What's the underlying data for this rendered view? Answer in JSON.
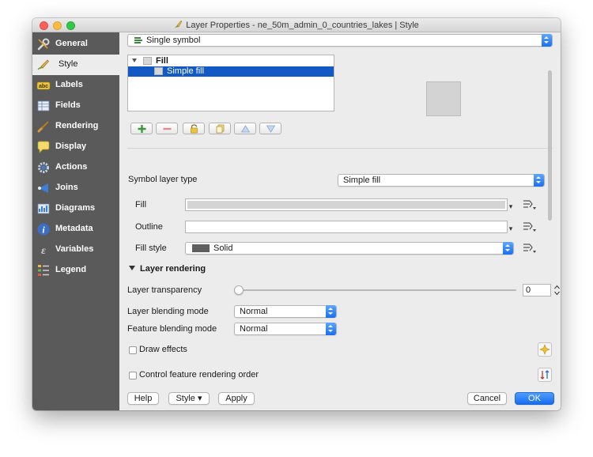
{
  "window": {
    "title": "Layer Properties - ne_50m_admin_0_countries_lakes | Style"
  },
  "sidebar": {
    "items": [
      {
        "label": "General",
        "icon": "wrench-icon",
        "active": false
      },
      {
        "label": "Style",
        "icon": "paintbrush-icon",
        "active": true
      },
      {
        "label": "Labels",
        "icon": "abc-label-icon",
        "active": false
      },
      {
        "label": "Fields",
        "icon": "table-fields-icon",
        "active": false
      },
      {
        "label": "Rendering",
        "icon": "brush-render-icon",
        "active": false
      },
      {
        "label": "Display",
        "icon": "speech-bubble-icon",
        "active": false
      },
      {
        "label": "Actions",
        "icon": "gear-actions-icon",
        "active": false
      },
      {
        "label": "Joins",
        "icon": "join-arrow-icon",
        "active": false
      },
      {
        "label": "Diagrams",
        "icon": "diagram-icon",
        "active": false
      },
      {
        "label": "Metadata",
        "icon": "info-icon",
        "active": false
      },
      {
        "label": "Variables",
        "icon": "variables-icon",
        "active": false
      },
      {
        "label": "Legend",
        "icon": "legend-icon",
        "active": false
      }
    ]
  },
  "renderer": {
    "selected": "Single symbol"
  },
  "symbol_tree": {
    "items": [
      {
        "label": "Fill",
        "selected": false
      },
      {
        "label": "Simple fill",
        "selected": true
      }
    ]
  },
  "symbol_layer": {
    "type_label": "Symbol layer type",
    "type_value": "Simple fill",
    "fill_label": "Fill",
    "outline_label": "Outline",
    "fill_style_label": "Fill style",
    "fill_style_value": "Solid"
  },
  "layer_rendering": {
    "section_title": "Layer rendering",
    "transparency_label": "Layer transparency",
    "transparency_value": "0",
    "transparency_level": 0,
    "layer_blending_label": "Layer blending mode",
    "layer_blending_value": "Normal",
    "feature_blending_label": "Feature blending mode",
    "feature_blending_value": "Normal",
    "draw_effects_label": "Draw effects",
    "control_order_label": "Control feature rendering order"
  },
  "footer": {
    "help": "Help",
    "style": "Style ▾",
    "apply": "Apply",
    "cancel": "Cancel",
    "ok": "OK"
  },
  "colors": {
    "accent": "#1a6ff0",
    "selection": "#1259c3",
    "sidebar_bg": "#5a5a5a"
  }
}
